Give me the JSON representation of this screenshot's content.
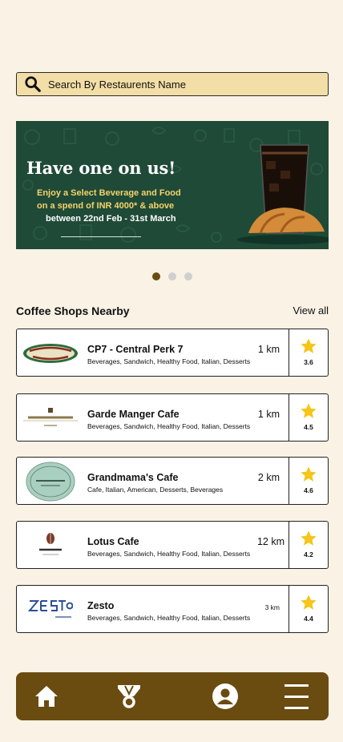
{
  "search": {
    "placeholder": "Search By Restaurents Name"
  },
  "banner": {
    "headline": "Have one on us!",
    "line1": "Enjoy a Select Beverage and Food",
    "line2": "on a spend of INR 4000* & above",
    "line3": "between 22nd Feb - 31st March"
  },
  "carousel": {
    "count": 3,
    "active": 0
  },
  "nearby": {
    "title": "Coffee Shops Nearby",
    "view_all": "View all",
    "items": [
      {
        "name": "CP7 - Central Perk 7",
        "tags": "Beverages, Sandwich, Healthy Food, Italian, Desserts",
        "distance": "1 km",
        "rating": "3.6",
        "logo_text": "CENTRAL PERK"
      },
      {
        "name": "Garde Manger Cafe",
        "tags": "Beverages, Sandwich, Healthy Food, Italian, Desserts",
        "distance": "1 km",
        "rating": "4.5",
        "logo_text": "GARDE MANGER"
      },
      {
        "name": "Grandmama's Cafe",
        "tags": "Cafe, Italian, American, Desserts, Beverages",
        "distance": "2 km",
        "rating": "4.6",
        "logo_text": "GRANDMAMA'S"
      },
      {
        "name": "Lotus Cafe",
        "tags": "Beverages, Sandwich, Healthy Food, Italian, Desserts",
        "distance": "12 km",
        "rating": "4.2",
        "logo_text": "LOTUS"
      },
      {
        "name": "Zesto",
        "tags": "Beverages, Sandwich, Healthy Food, Italian, Desserts",
        "distance": "3 km",
        "rating": "4.4",
        "logo_text": "ZESTO"
      }
    ]
  },
  "nav": [
    "home-icon",
    "medal-icon",
    "profile-icon",
    "menu-icon"
  ],
  "colors": {
    "background": "#f9f2e5",
    "accent": "#6a4b10",
    "search_bg": "#f2dea6",
    "star": "#f5c518",
    "banner_bg": "#1f4a37"
  }
}
